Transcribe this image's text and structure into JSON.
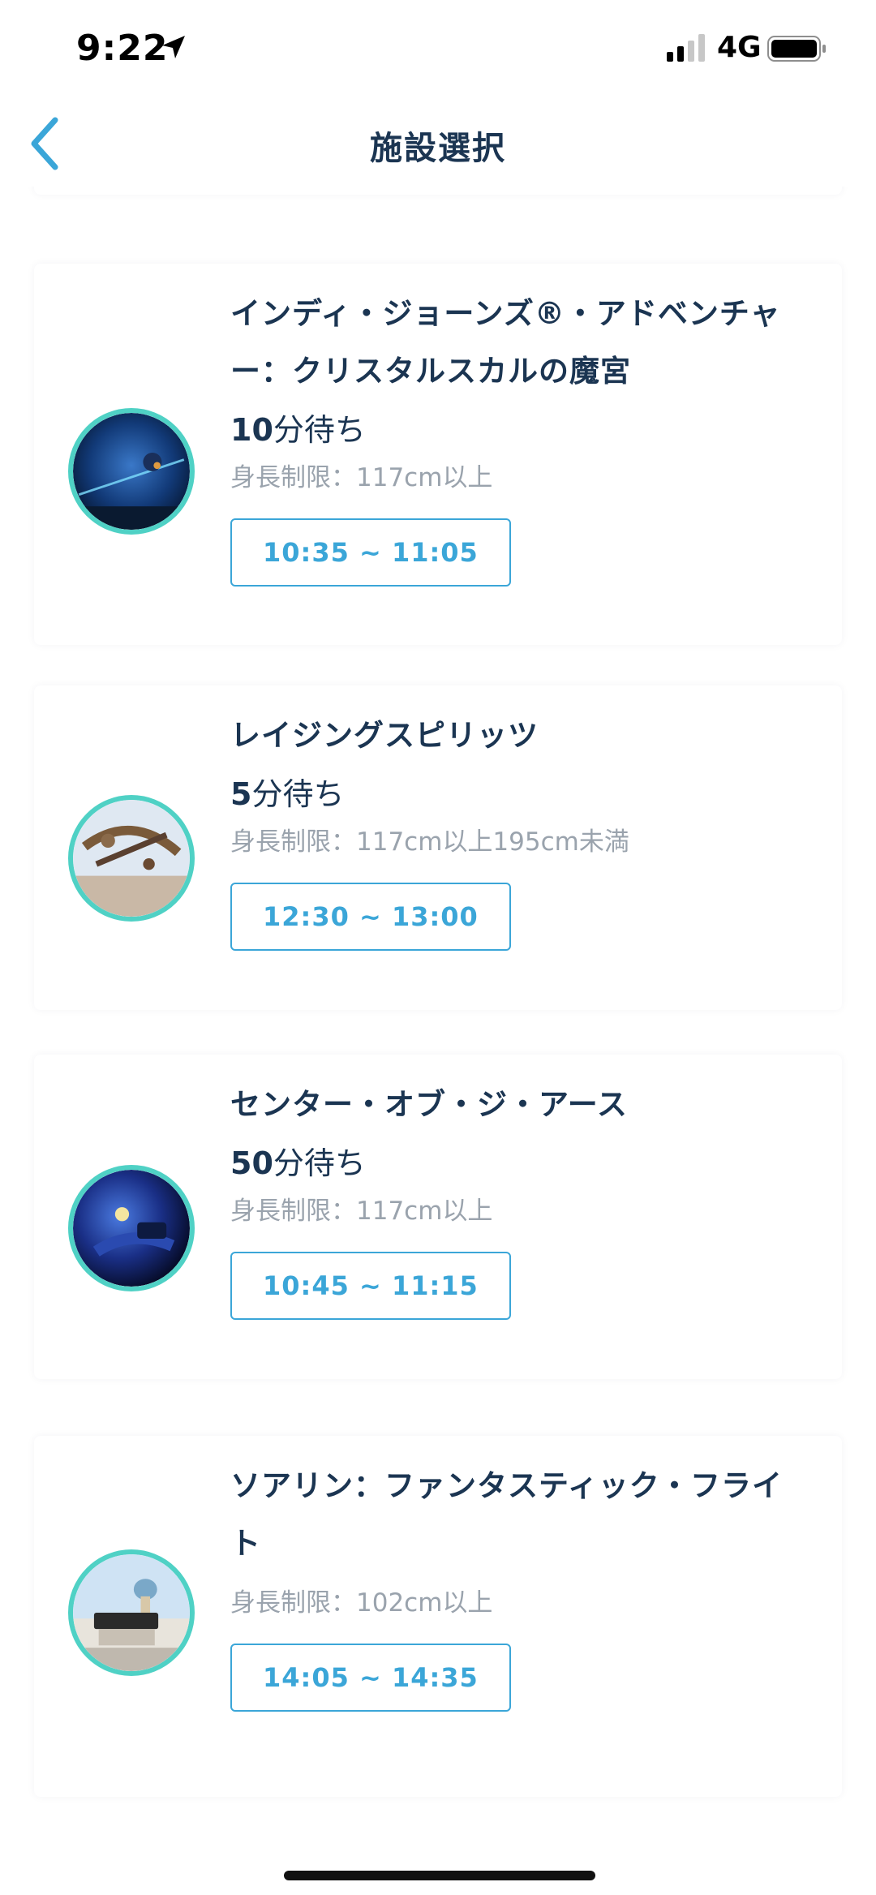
{
  "status_bar": {
    "time": "9:22",
    "network": "4G"
  },
  "nav": {
    "title": "施設選択"
  },
  "attractions": [
    {
      "name": "インディ・ジョーンズ®・アドベンチャー：クリスタルスカルの魔宮",
      "wait_number": "10",
      "wait_suffix": "分待ち",
      "height_limit": "身長制限：117cm以上",
      "time_slot": "10:35 ~ 11:05"
    },
    {
      "name": "レイジングスピリッツ",
      "wait_number": "5",
      "wait_suffix": "分待ち",
      "height_limit": "身長制限：117cm以上195cm未満",
      "time_slot": "12:30 ~ 13:00"
    },
    {
      "name": "センター・オブ・ジ・アース",
      "wait_number": "50",
      "wait_suffix": "分待ち",
      "height_limit": "身長制限：117cm以上",
      "time_slot": "10:45 ~ 11:15"
    },
    {
      "name": "ソアリン：ファンタスティック・フライト",
      "height_limit": "身長制限：102cm以上",
      "time_slot": "14:05 ~ 14:35"
    }
  ],
  "colors": {
    "accent": "#3ba6d8",
    "text_dark": "#1b3552",
    "text_muted": "#9aa3ad",
    "thumb_ring": "#4fd1c5"
  },
  "icons": [
    "location-arrow-icon",
    "signal-icon",
    "battery-icon",
    "back-chevron-icon"
  ]
}
